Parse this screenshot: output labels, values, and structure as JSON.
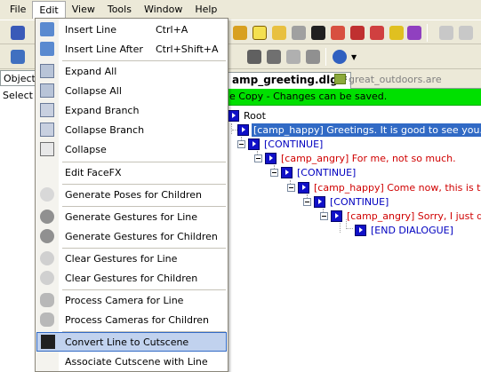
{
  "menubar": [
    "File",
    "Edit",
    "View",
    "Tools",
    "Window",
    "Help"
  ],
  "left_panel": {
    "tab_label": "Object",
    "text": "Select a"
  },
  "doc_tabs": {
    "active": "amp_greeting.dlg *",
    "inactive": "great_outdoors.are"
  },
  "status_text": "e Copy - Changes can be saved.",
  "tree": {
    "root": "Root",
    "nodes": [
      {
        "text": "[camp_happy] Greetings. It is good to see you.",
        "color": "#ffffff"
      },
      {
        "text": "[CONTINUE]",
        "color": "#0000c0"
      },
      {
        "text": "[camp_angry] For me, not so much.",
        "color": "#d00000"
      },
      {
        "text": "[CONTINUE]",
        "color": "#0000c0"
      },
      {
        "text": "[camp_happy] Come now, this is the l",
        "color": "#d00000"
      },
      {
        "text": "[CONTINUE]",
        "color": "#0000c0"
      },
      {
        "text": "[camp_angry] Sorry, I just do",
        "color": "#d00000"
      },
      {
        "text": "[END DIALOGUE]",
        "color": "#0000c0"
      }
    ]
  },
  "edit_menu": [
    {
      "label": "Insert Line",
      "shortcut": "Ctrl+A",
      "icon": "insert-line-icon"
    },
    {
      "label": "Insert Line After",
      "shortcut": "Ctrl+Shift+A",
      "icon": "insert-line-after-icon"
    },
    {
      "label": "Expand All",
      "shortcut": "",
      "icon": "expand-all-icon"
    },
    {
      "label": "Collapse All",
      "shortcut": "",
      "icon": "collapse-all-icon"
    },
    {
      "label": "Expand Branch",
      "shortcut": "",
      "icon": "expand-branch-icon"
    },
    {
      "label": "Collapse Branch",
      "shortcut": "",
      "icon": "collapse-branch-icon"
    },
    {
      "label": "Collapse",
      "shortcut": "",
      "icon": "collapse-icon"
    },
    {
      "label": "Edit FaceFX",
      "shortcut": "",
      "icon": ""
    },
    {
      "label": "Generate Poses for Children",
      "shortcut": "",
      "icon": "pose-figure-icon"
    },
    {
      "label": "Generate Gestures for Line",
      "shortcut": "",
      "icon": "gesture-gear-icon"
    },
    {
      "label": "Generate Gestures for Children",
      "shortcut": "",
      "icon": "gesture-gear-icon"
    },
    {
      "label": "Clear Gestures for Line",
      "shortcut": "",
      "icon": "clear-gesture-icon"
    },
    {
      "label": "Clear Gestures for Children",
      "shortcut": "",
      "icon": "clear-gesture-icon"
    },
    {
      "label": "Process Camera for Line",
      "shortcut": "",
      "icon": "camera-people-icon"
    },
    {
      "label": "Process Cameras for Children",
      "shortcut": "",
      "icon": "camera-people-icon"
    },
    {
      "label": "Convert Line to Cutscene",
      "shortcut": "",
      "icon": "clapperboard-icon"
    },
    {
      "label": "Associate Cutscene with Line",
      "shortcut": "",
      "icon": ""
    }
  ]
}
